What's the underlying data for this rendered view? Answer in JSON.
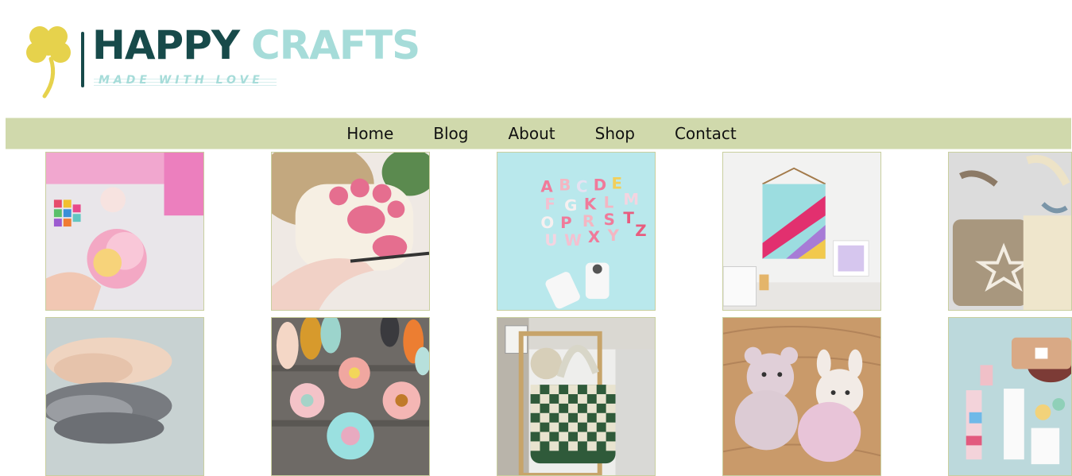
{
  "logo": {
    "word1": "HAPPY",
    "word2": "CRAFTS",
    "tagline": "MADE WITH LOVE",
    "icon": "clover-icon",
    "colors": {
      "dark": "#174a4a",
      "light": "#a6dcd9",
      "clover": "#e6d24c"
    }
  },
  "nav": {
    "background": "#d0d9ac",
    "items": [
      {
        "label": "Home"
      },
      {
        "label": "Blog"
      },
      {
        "label": "About"
      },
      {
        "label": "Shop"
      },
      {
        "label": "Contact"
      }
    ]
  },
  "gallery": {
    "images": [
      {
        "subject": "pink paper flower craft"
      },
      {
        "subject": "crochet cat paw gloves"
      },
      {
        "subject": "alphabet letter keychains"
      },
      {
        "subject": "woven yarn wall hanging"
      },
      {
        "subject": "crochet tote bags"
      },
      {
        "subject": "yarn skeins"
      },
      {
        "subject": "crochet flowers with thread spools"
      },
      {
        "subject": "checkered crochet bag"
      },
      {
        "subject": "crochet plush bears"
      },
      {
        "subject": "yarn kit with stickers"
      }
    ]
  }
}
